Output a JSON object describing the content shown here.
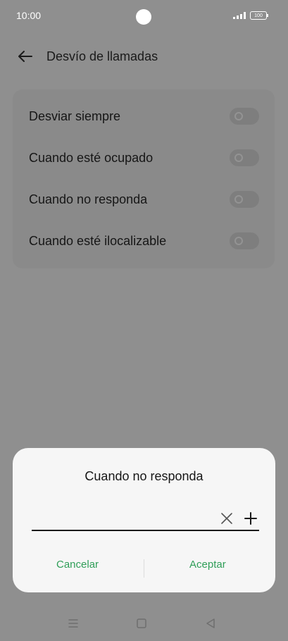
{
  "status_bar": {
    "time": "10:00",
    "battery": "100"
  },
  "header": {
    "title": "Desvío de llamadas",
    "back_icon": "arrow-left-icon"
  },
  "settings": {
    "items": [
      {
        "label": "Desviar siempre",
        "enabled": false
      },
      {
        "label": "Cuando esté ocupado",
        "enabled": false
      },
      {
        "label": "Cuando no responda",
        "enabled": false
      },
      {
        "label": "Cuando esté ilocalizable",
        "enabled": false
      }
    ]
  },
  "dialog": {
    "title": "Cuando no responda",
    "input_value": "",
    "clear_icon": "clear-icon",
    "add_icon": "add-contact-icon",
    "cancel_label": "Cancelar",
    "accept_label": "Aceptar",
    "accent_color": "#2f9e58"
  },
  "nav_bar": {
    "icons": [
      "menu-icon",
      "home-icon",
      "back-triangle-icon"
    ]
  }
}
